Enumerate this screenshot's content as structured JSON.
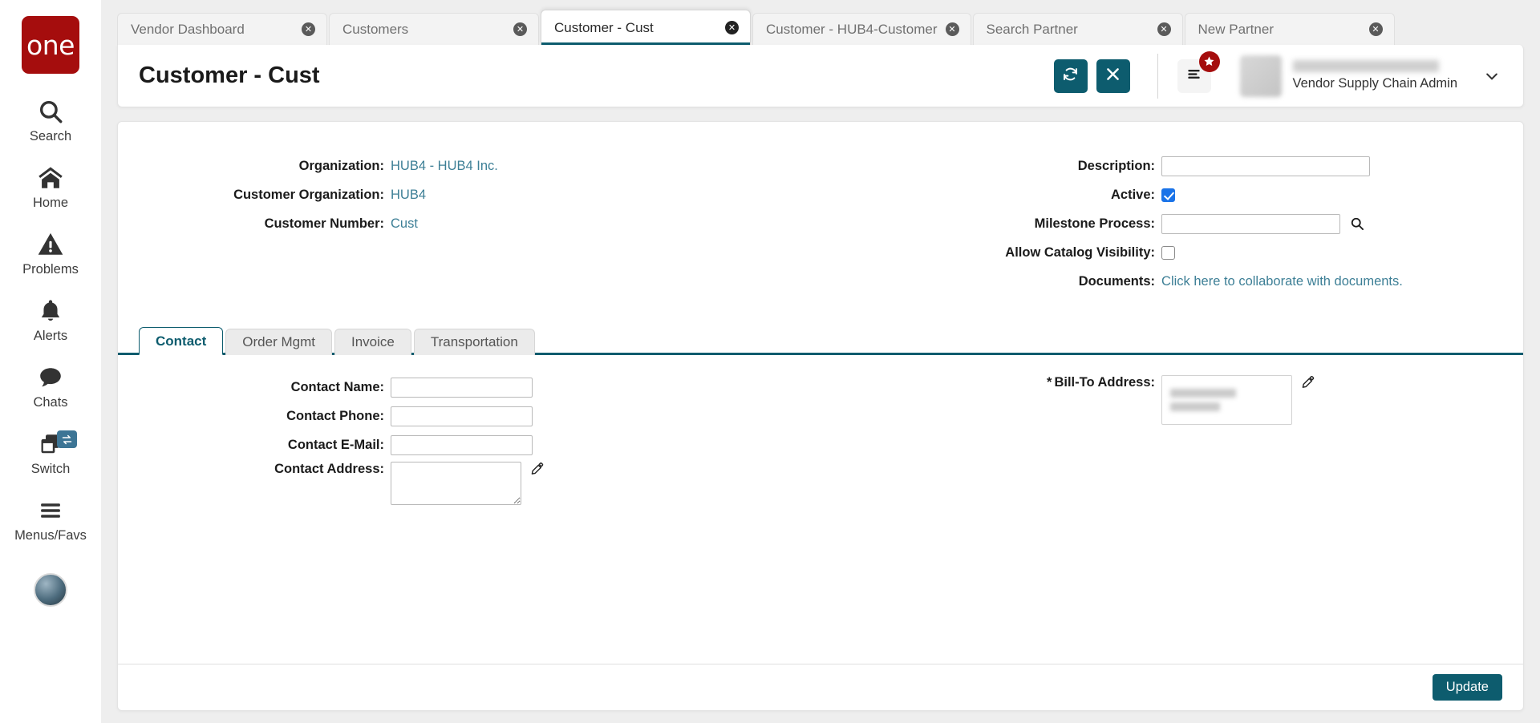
{
  "brand": {
    "logo_text": "one",
    "logo_color": "#a50d0d"
  },
  "theme": {
    "accent": "#0d5c6e",
    "link": "#3d7f96",
    "checkbox_checked": "#1a73e8",
    "badge_red": "#a50d0d"
  },
  "sidebar": {
    "items": [
      {
        "label": "Search",
        "icon": "search-icon"
      },
      {
        "label": "Home",
        "icon": "home-icon"
      },
      {
        "label": "Problems",
        "icon": "warning-triangle-icon"
      },
      {
        "label": "Alerts",
        "icon": "bell-icon"
      },
      {
        "label": "Chats",
        "icon": "chat-bubble-icon"
      },
      {
        "label": "Switch",
        "icon": "switch-windows-icon",
        "badge_icon": "swap-arrows-icon"
      },
      {
        "label": "Menus/Favs",
        "icon": "hamburger-icon"
      }
    ]
  },
  "tabstrip": {
    "tabs": [
      {
        "label": "Vendor Dashboard",
        "active": false
      },
      {
        "label": "Customers",
        "active": false
      },
      {
        "label": "Customer - Cust",
        "active": true
      },
      {
        "label": "Customer - HUB4-Customer",
        "active": false
      },
      {
        "label": "Search Partner",
        "active": false
      },
      {
        "label": "New Partner",
        "active": false
      }
    ],
    "close_glyph": "✕"
  },
  "header": {
    "title": "Customer - Cust",
    "refresh_icon": "refresh-icon",
    "close_icon": "close-icon",
    "menu_icon": "hamburger-menu-icon",
    "star_badge_icon": "star-icon",
    "user_role": "Vendor Supply Chain Admin",
    "caret_icon": "chevron-down-icon"
  },
  "form_top": {
    "left": [
      {
        "label": "Organization:",
        "value": "HUB4 - HUB4 Inc.",
        "type": "link"
      },
      {
        "label": "Customer Organization:",
        "value": "HUB4",
        "type": "link"
      },
      {
        "label": "Customer Number:",
        "value": "Cust",
        "type": "link"
      }
    ],
    "right": {
      "description_label": "Description:",
      "description_value": "",
      "active_label": "Active:",
      "active_checked": true,
      "milestone_label": "Milestone Process:",
      "milestone_value": "",
      "milestone_search_icon": "magnifier-icon",
      "catalog_label": "Allow Catalog Visibility:",
      "catalog_checked": false,
      "documents_label": "Documents:",
      "documents_link": "Click here to collaborate with documents."
    }
  },
  "inner_tabs": [
    {
      "label": "Contact",
      "active": true
    },
    {
      "label": "Order Mgmt",
      "active": false
    },
    {
      "label": "Invoice",
      "active": false
    },
    {
      "label": "Transportation",
      "active": false
    }
  ],
  "contact_panel": {
    "left": [
      {
        "label": "Contact Name:",
        "value": "",
        "kind": "input"
      },
      {
        "label": "Contact Phone:",
        "value": "",
        "kind": "input"
      },
      {
        "label": "Contact E-Mail:",
        "value": "",
        "kind": "input"
      },
      {
        "label": "Contact Address:",
        "value": "",
        "kind": "textarea",
        "edit_icon": "edit-pencil-icon"
      }
    ],
    "right": {
      "required_marker": "*",
      "billto_label": "Bill-To Address:",
      "billto_value": "",
      "edit_icon": "edit-pencil-icon"
    }
  },
  "footer": {
    "update_label": "Update"
  }
}
